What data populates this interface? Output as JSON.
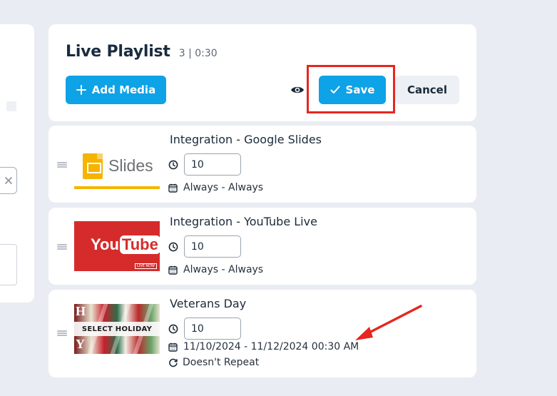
{
  "playlist": {
    "title": "Live Playlist",
    "meta": "3 | 0:30"
  },
  "toolbar": {
    "add_label": "Add Media",
    "save_label": "Save",
    "cancel_label": "Cancel",
    "preview_icon": "eye-icon"
  },
  "colors": {
    "accent": "#0ea2e6",
    "highlight": "#e6261f",
    "background": "#e9ecf2"
  },
  "items": [
    {
      "title": "Integration - Google Slides",
      "duration": "10",
      "schedule": "Always - Always",
      "thumb": {
        "label": "Slides"
      }
    },
    {
      "title": "Integration - YouTube Live",
      "duration": "10",
      "schedule": "Always - Always",
      "thumb": {
        "label_you": "You",
        "label_tube": "Tube",
        "badge": "LIVE NOW"
      }
    },
    {
      "title": "Veterans Day",
      "duration": "10",
      "schedule": "11/10/2024 - 11/12/2024 00:30 AM",
      "repeat": "Doesn't Repeat",
      "thumb": {
        "label": "SELECT HOLIDAY",
        "letter_top": "H",
        "letter_bottom": "Y"
      }
    }
  ]
}
